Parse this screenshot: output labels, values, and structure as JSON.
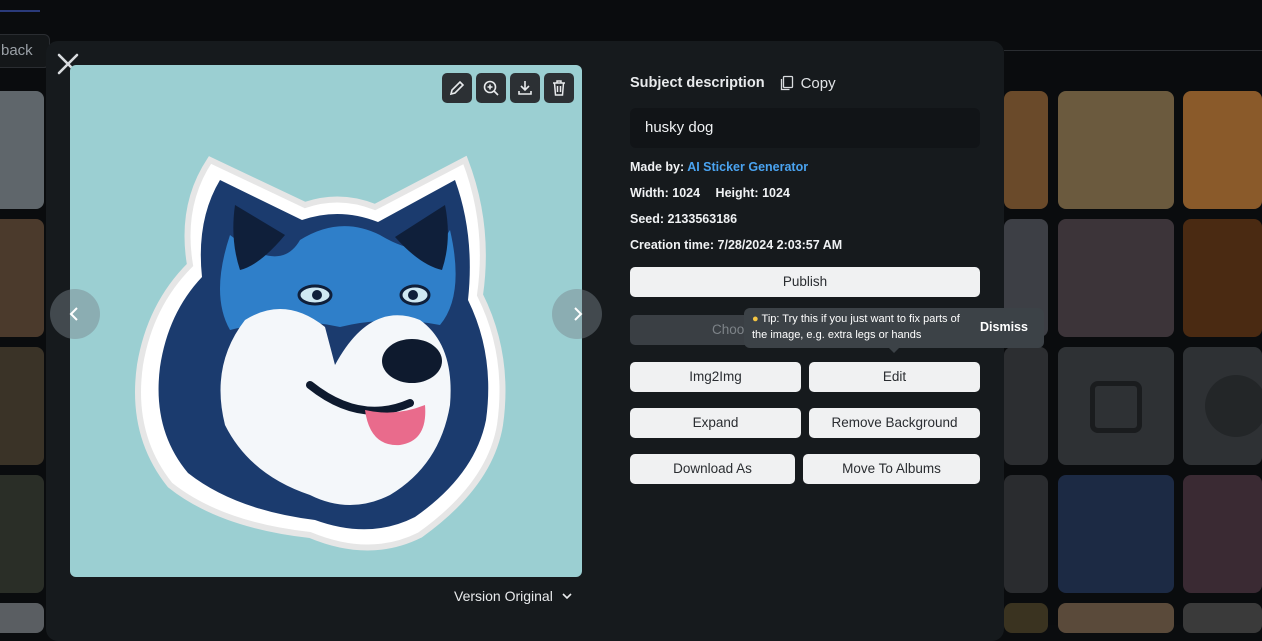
{
  "background": {
    "back_label": "back"
  },
  "image_viewer": {
    "close_icon": "close-icon",
    "tools": [
      "pencil-icon",
      "zoom-in-icon",
      "download-icon",
      "trash-icon"
    ],
    "version_label": "Version Original"
  },
  "details": {
    "subject_heading": "Subject description",
    "copy_label": "Copy",
    "subject_text": "husky dog",
    "made_by_label": "Made by:",
    "made_by_value": "AI Sticker Generator",
    "width_label": "Width:",
    "width_value": "1024",
    "height_label": "Height:",
    "height_value": "1024",
    "seed_label": "Seed:",
    "seed_value": "2133563186",
    "creation_label": "Creation time:",
    "creation_value": "7/28/2024 2:03:57 AM"
  },
  "actions": {
    "publish": "Publish",
    "choose": "Choo",
    "img2img": "Img2Img",
    "edit": "Edit",
    "expand": "Expand",
    "remove_background": "Remove Background",
    "download_as": "Download As",
    "move_to_albums": "Move To Albums"
  },
  "tip": {
    "icon": "lightbulb-icon",
    "text": "Tip: Try this if you just want to fix parts of the image, e.g. extra legs or hands",
    "dismiss": "Dismiss"
  },
  "colors": {
    "modal_bg": "#161a1d",
    "accent_link": "#4aa3f0",
    "image_bg": "#9bcfd2"
  }
}
